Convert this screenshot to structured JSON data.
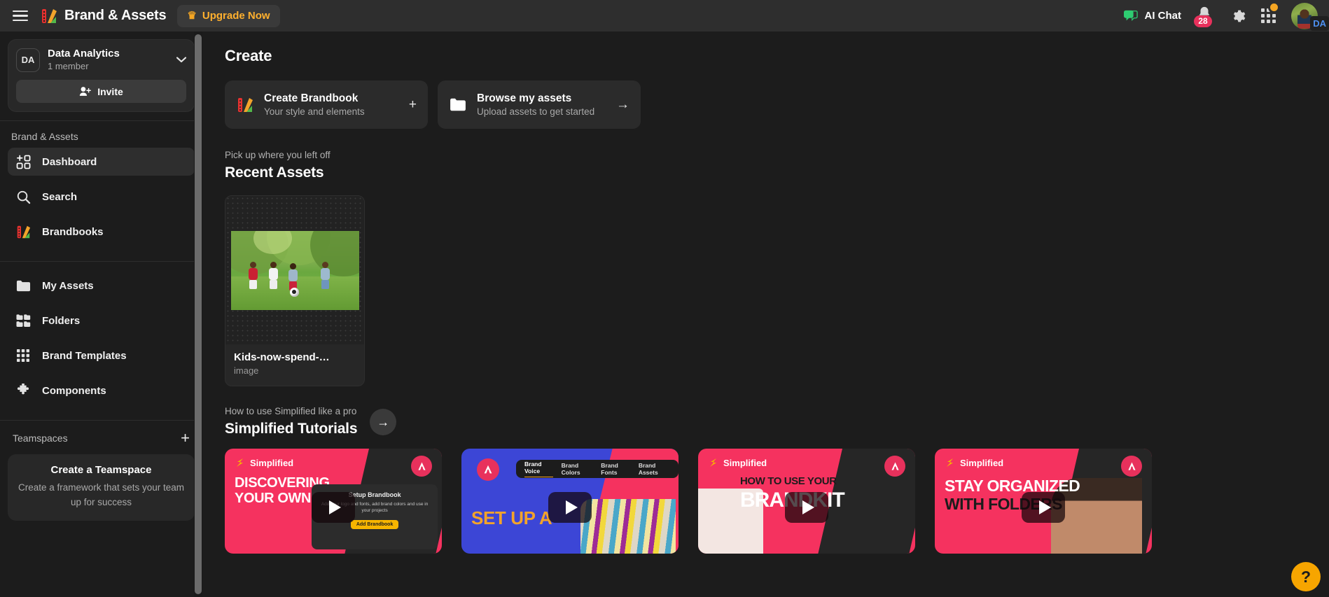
{
  "header": {
    "menu_icon": "hamburger-icon",
    "logo_icon": "brand-assets-logo",
    "title": "Brand & Assets",
    "upgrade_label": "Upgrade Now",
    "upgrade_icon": "crown-icon",
    "ai_chat_label": "AI Chat",
    "ai_chat_icon": "chat-bubble-icon",
    "bell_icon": "bell-icon",
    "notification_count": "28",
    "gear_icon": "gear-icon",
    "apps_icon": "app-grid-icon",
    "avatar_icon": "user-avatar",
    "avatar_tag": "DA"
  },
  "sidebar": {
    "workspace": {
      "initials": "DA",
      "name": "Data Analytics",
      "members": "1 member",
      "chevron_icon": "chevron-down-icon",
      "invite_label": "Invite",
      "invite_icon": "user-plus-icon"
    },
    "section_label": "Brand & Assets",
    "items": [
      {
        "label": "Dashboard",
        "icon": "dashboard-grid-icon",
        "active": true
      },
      {
        "label": "Search",
        "icon": "search-icon",
        "active": false
      },
      {
        "label": "Brandbooks",
        "icon": "brandbooks-icon",
        "active": false
      },
      {
        "label": "My Assets",
        "icon": "folder-icon",
        "active": false
      },
      {
        "label": "Folders",
        "icon": "folders-grid-icon",
        "active": false
      },
      {
        "label": "Brand Templates",
        "icon": "nine-dots-icon",
        "active": false
      },
      {
        "label": "Components",
        "icon": "puzzle-piece-icon",
        "active": false
      }
    ],
    "teamspaces": {
      "title": "Teamspaces",
      "add_icon": "plus-icon",
      "card_title": "Create a Teamspace",
      "card_desc": "Create a framework that sets your team up for success"
    }
  },
  "main": {
    "create_heading": "Create",
    "create_cards": [
      {
        "title": "Create Brandbook",
        "subtitle": "Your style and elements",
        "icon": "brandbooks-icon",
        "action_icon": "plus-icon",
        "action_glyph": "+"
      },
      {
        "title": "Browse my assets",
        "subtitle": "Upload assets to get started",
        "icon": "folder-icon",
        "action_icon": "arrow-right-icon",
        "action_glyph": "→"
      }
    ],
    "recent": {
      "kicker": "Pick up where you left off",
      "heading": "Recent Assets",
      "assets": [
        {
          "name": "Kids-now-spend-…",
          "type": "image",
          "thumb_alt": "children playing soccer in a park"
        }
      ]
    },
    "tutorials": {
      "kicker": "How to use Simplified like a pro",
      "heading": "Simplified Tutorials",
      "arrow_icon": "arrow-right-icon",
      "cards": [
        {
          "brand": "Simplified",
          "title_line1": "DISCOVERING",
          "title_line2": "YOUR OWN",
          "bg": "#f5325f",
          "title_color": "#ffffff",
          "overlay_title": "Setup Brandbook",
          "overlay_desc": "Add your logo and fonts, add brand colors and use in your projects",
          "overlay_button": "Add Brandbook",
          "badge_icon": "simplified-logo-badge",
          "play_icon": "play-icon"
        },
        {
          "brand": "",
          "title_line1": "SET UP A",
          "title_line2": "",
          "bg": "#3c46d6",
          "title_color": "#f2a32b",
          "tabs": [
            "Brand Voice",
            "Brand Colors",
            "Brand Fonts",
            "Brand Assets"
          ],
          "badge_icon": "simplified-logo-badge",
          "play_icon": "play-icon"
        },
        {
          "brand": "Simplified",
          "title_line1": "HOW TO USE YOUR",
          "title_line2": "BRANDKIT",
          "bg": "#f5325f",
          "title_color": "#1c1c1c",
          "badge_icon": "simplified-logo-badge",
          "play_icon": "play-icon"
        },
        {
          "brand": "Simplified",
          "title_line1": "STAY ORGANIZED",
          "title_line2": "WITH FOLDERS",
          "bg": "#f5325f",
          "title_color": "#ffffff",
          "badge_icon": "simplified-logo-badge",
          "play_icon": "play-icon"
        }
      ]
    },
    "help_fab": {
      "glyph": "?",
      "icon": "help-icon"
    }
  },
  "colors": {
    "accent_pink": "#f5325f",
    "accent_orange": "#f7a500",
    "accent_blue": "#3c46d6",
    "surface": "#2b2b2b",
    "background": "#1c1c1c"
  }
}
